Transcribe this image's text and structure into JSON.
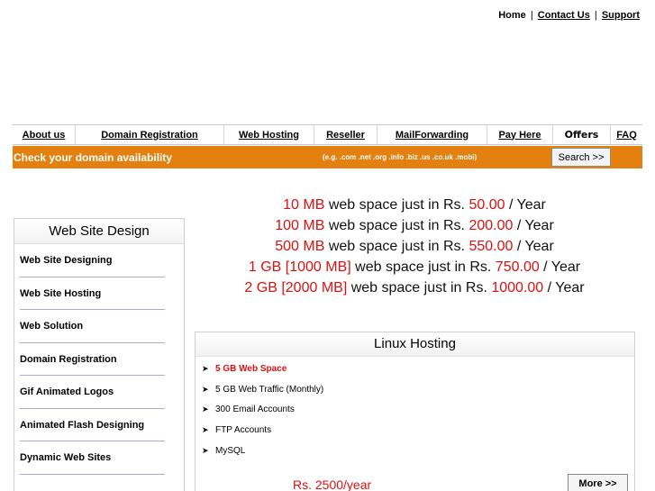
{
  "top_links": {
    "home": "Home",
    "sep1": "|",
    "contact": "Contact Us",
    "sep2": "|",
    "support": "Support"
  },
  "nav": [
    {
      "label": "About us"
    },
    {
      "label": "Domain Registration"
    },
    {
      "label": "Web Hosting"
    },
    {
      "label": "Reseller"
    },
    {
      "label": "MailForwarding"
    },
    {
      "label": "Pay Here"
    },
    {
      "label": "Offers"
    },
    {
      "label": "FAQ"
    }
  ],
  "domain_bar": {
    "label": "Check your domain availability",
    "extensions": "(e.g. .com .net .org .info .biz .us .co.uk .mobi)",
    "search_button": "Search >>"
  },
  "offers": [
    {
      "size": "10 MB",
      "text": " web space just in Rs. ",
      "price": "50.00",
      "suffix": " / Year"
    },
    {
      "size": "100 MB",
      "text": " web space just in Rs. ",
      "price": "200.00",
      "suffix": " / Year"
    },
    {
      "size": "500 MB",
      "text": " web space just in Rs. ",
      "price": "550.00",
      "suffix": " / Year"
    },
    {
      "size": "1 GB [1000 MB]",
      "text": " web space just in Rs. ",
      "price": "750.00",
      "suffix": " / Year"
    },
    {
      "size": "2 GB [2000 MB]",
      "text": " web space just in Rs. ",
      "price": "1000.00",
      "suffix": " / Year"
    }
  ],
  "sidebar": {
    "title": "Web Site Design",
    "items": [
      {
        "label": "Web Site Designing"
      },
      {
        "label": "Web Site Hosting"
      },
      {
        "label": "Web Solution"
      },
      {
        "label": "Domain Registration"
      },
      {
        "label": "Gif Animated Logos"
      },
      {
        "label": "Animated Flash Designing"
      },
      {
        "label": "Dynamic Web Sites"
      }
    ]
  },
  "linux_hosting": {
    "title": "Linux Hosting",
    "features": [
      {
        "text": "5 GB Web Space"
      },
      {
        "text": "5 GB Web Traffic (Monthly)"
      },
      {
        "text": "300 Email Accounts"
      },
      {
        "text": "FTP Accounts"
      },
      {
        "text": "MySQL"
      }
    ],
    "price": "Rs. 2500/year",
    "more_button": "More >>"
  },
  "colors": {
    "accent_orange": "#e4800f",
    "highlight_red": "#e01010"
  },
  "icons": {
    "bullet": "arrow-right-icon"
  }
}
